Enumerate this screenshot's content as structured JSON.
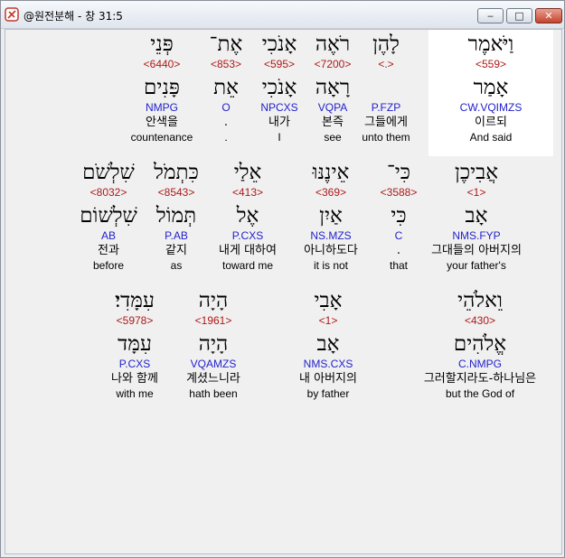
{
  "window": {
    "title": "@원전분해 - 창 31:5",
    "buttons": {
      "minimize": "‒",
      "maximize": "□",
      "close": "✕"
    },
    "icon": "app-logo-icon"
  },
  "verse_rows": [
    {
      "words": [
        {
          "word": "וַיֹּאמֶר",
          "strong": "<559>",
          "lemma": "אָמַר",
          "parse": "CW.VQIMZS",
          "korean": "이르되",
          "english": "And said",
          "highlighted": true
        },
        {
          "word": "לָהֶן",
          "strong": "<.>",
          "lemma": "",
          "parse": "P.FZP",
          "korean": "그들에게",
          "english": "unto them"
        },
        {
          "word": "רֹאֶה",
          "strong": "<7200>",
          "lemma": "רָאָה",
          "parse": "VQPA",
          "korean": "본즉",
          "english": "see"
        },
        {
          "word": "אָנֹכִי",
          "strong": "<595>",
          "lemma": "אָנֹכִי",
          "parse": "NPCXS",
          "korean": "내가",
          "english": "I"
        },
        {
          "word": "אֶת־",
          "strong": "<853>",
          "lemma": "אֵת",
          "parse": "O",
          "korean": ".",
          "english": "."
        },
        {
          "word": "פְּנֵי",
          "strong": "<6440>",
          "lemma": "פָּנִים",
          "parse": "NMPG",
          "korean": "안색을",
          "english": "countenance"
        }
      ]
    },
    {
      "words": [
        {
          "word": "אֲבִיכֶן",
          "strong": "<1>",
          "lemma": "אָב",
          "parse": "NMS.FYP",
          "korean": "그대들의 아버지의",
          "english": "your father's"
        },
        {
          "word": "כִּי־",
          "strong": "<3588>",
          "lemma": "כִּי",
          "parse": "C",
          "korean": ".",
          "english": "that"
        },
        {
          "word": "אֵינֶנּוּ",
          "strong": "<369>",
          "lemma": "אַיִן",
          "parse": "NS.MZS",
          "korean": "아니하도다",
          "english": "it is not"
        },
        {
          "word": "אֵלַי",
          "strong": "<413>",
          "lemma": "אֶל",
          "parse": "P.CXS",
          "korean": "내게 대하여",
          "english": "toward me"
        },
        {
          "word": "כִּתְמֹל",
          "strong": "<8543>",
          "lemma": "תְּמוֹל",
          "parse": "P.AB",
          "korean": "같지",
          "english": "as"
        },
        {
          "word": "שִׁלְשֹׁם",
          "strong": "<8032>",
          "lemma": "שִׁלְשׁוֹם",
          "parse": "AB",
          "korean": "전과",
          "english": "before"
        }
      ]
    },
    {
      "words": [
        {
          "word": "וֵאלֹהֵי",
          "strong": "<430>",
          "lemma": "אֱלֹהִים",
          "parse": "C.NMPG",
          "korean": "그러할지라도-하나님은",
          "english": "but the God of"
        },
        {
          "word": "אָבִי",
          "strong": "<1>",
          "lemma": "אָב",
          "parse": "NMS.CXS",
          "korean": "내 아버지의",
          "english": "by father"
        },
        {
          "word": "הָיָה",
          "strong": "<1961>",
          "lemma": "הָיָה",
          "parse": "VQAMZS",
          "korean": "계셨느니라",
          "english": "hath been"
        },
        {
          "word": "עִמָּדִי׃",
          "strong": "<5978>",
          "lemma": "עִמָּד",
          "parse": "P.CXS",
          "korean": "나와 함께",
          "english": "with me"
        }
      ]
    }
  ],
  "colors": {
    "strong_number": "#b01818",
    "parsing_code": "#2222cc",
    "highlight": "#ffffff",
    "background": "#f0f0f0"
  }
}
